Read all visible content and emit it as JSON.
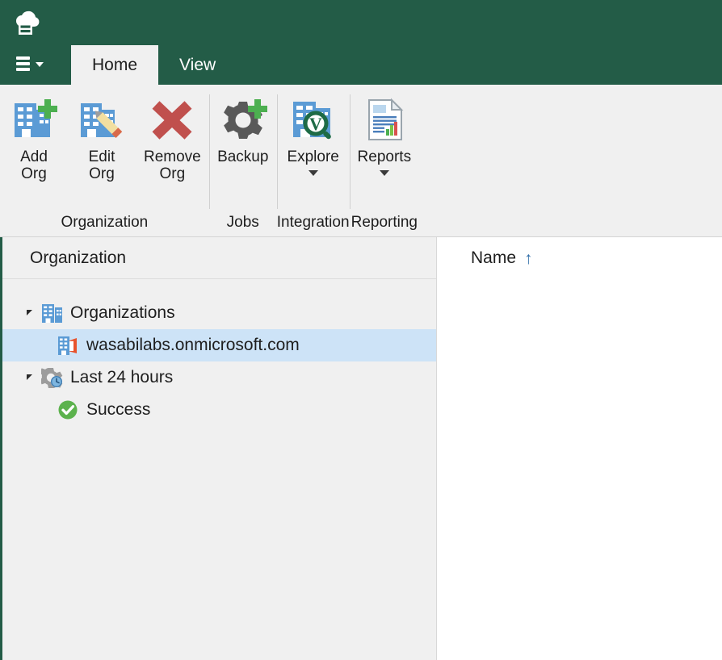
{
  "window": {
    "logo_icon": "cloud-archive-logo",
    "accent_green": "#235C47",
    "ribbon_bg": "#F0F0F0",
    "selection_blue": "#CDE3F7"
  },
  "quick_access": {
    "menu_icon": "hamburger-menu-icon",
    "caret_icon": "chevron-down-icon"
  },
  "tabs": [
    {
      "label": "Home",
      "active": true
    },
    {
      "label": "View",
      "active": false
    }
  ],
  "ribbon": {
    "groups": [
      {
        "label": "Organization",
        "buttons": [
          {
            "label": "Add\nOrg",
            "icon": "building-add-icon",
            "dropdown": false
          },
          {
            "label": "Edit\nOrg",
            "icon": "building-edit-icon",
            "dropdown": false
          },
          {
            "label": "Remove\nOrg",
            "icon": "red-x-remove-icon",
            "dropdown": false
          }
        ]
      },
      {
        "label": "Jobs",
        "buttons": [
          {
            "label": "Backup",
            "icon": "gear-add-backup-icon",
            "dropdown": false
          }
        ]
      },
      {
        "label": "Integration",
        "buttons": [
          {
            "label": "Explore",
            "icon": "veeam-explorer-magnifier-icon",
            "dropdown": true
          }
        ]
      },
      {
        "label": "Reporting",
        "buttons": [
          {
            "label": "Reports",
            "icon": "report-document-chart-icon",
            "dropdown": true
          }
        ]
      }
    ]
  },
  "tree_panel": {
    "header": "Organization",
    "nodes": [
      {
        "label": "Organizations",
        "icon": "organizations-buildings-icon",
        "level": 0,
        "expanded": true,
        "selected": false
      },
      {
        "label": "wasabilabs.onmicrosoft.com",
        "icon": "office365-org-icon",
        "level": 1,
        "expanded": null,
        "selected": true
      },
      {
        "label": "Last 24 hours",
        "icon": "gear-clock-history-icon",
        "level": 0,
        "expanded": true,
        "selected": false
      },
      {
        "label": "Success",
        "icon": "green-check-success-icon",
        "level": 1,
        "expanded": null,
        "selected": false
      }
    ]
  },
  "list_panel": {
    "columns": [
      {
        "label": "Name",
        "sort": "ascending",
        "sort_glyph": "↑"
      }
    ],
    "rows": []
  }
}
